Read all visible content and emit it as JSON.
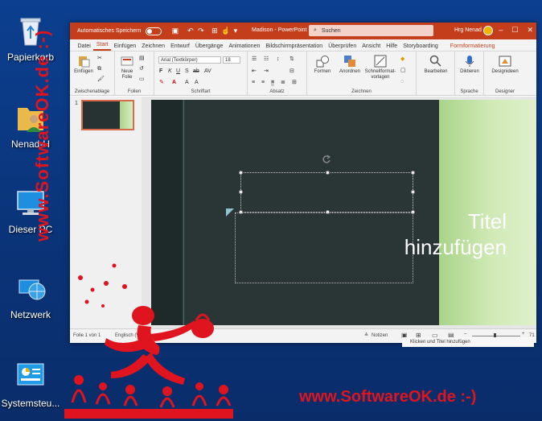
{
  "desktop": {
    "icons": [
      {
        "label": "Papierkorb",
        "icon": "recycle-bin-icon"
      },
      {
        "label": "Nenad-H",
        "icon": "user-folder-icon"
      },
      {
        "label": "Dieser PC",
        "icon": "computer-icon"
      },
      {
        "label": "Netzwerk",
        "icon": "network-icon"
      },
      {
        "label": "Systemsteu...",
        "icon": "control-panel-icon"
      }
    ],
    "watermark_vertical": "www.SoftwareOK.de :-)",
    "watermark_horizontal": "www.SoftwareOK.de :-)"
  },
  "app": {
    "autosave_label": "Automatisches Speichern",
    "window_title": "Madison  -  PowerPoint",
    "search_placeholder": "Suchen",
    "user_name": "Hrg Nenad",
    "accent": "#c43e1c"
  },
  "tabs": [
    "Datei",
    "Start",
    "Einfügen",
    "Zeichnen",
    "Entwurf",
    "Übergänge",
    "Animationen",
    "Bildschirmpräsentation",
    "Überprüfen",
    "Ansicht",
    "Hilfe",
    "Storyboarding"
  ],
  "active_tab": "Start",
  "context_tab": "Formformatierung",
  "ribbon": {
    "clipboard": {
      "paste": "Einfügen",
      "label": "Zwischenablage"
    },
    "slides": {
      "new_slide_line1": "Neue",
      "new_slide_line2": "Folie",
      "label": "Folien"
    },
    "font": {
      "name": "Arial (Textkörper)",
      "size": "18",
      "label": "Schriftart"
    },
    "paragraph": {
      "label": "Absatz"
    },
    "drawing": {
      "shapes": "Formen",
      "arrange": "Anordnen",
      "quickstyles_line1": "Schnellformat-",
      "quickstyles_line2": "vorlagen",
      "label": "Zeichnen"
    },
    "editing": {
      "label": "Bearbeiten"
    },
    "voice": {
      "dictate": "Diktieren",
      "label": "Sprache"
    },
    "designer": {
      "ideas": "Designideen",
      "label": "Designer"
    }
  },
  "slides_panel": {
    "number": "1"
  },
  "slide": {
    "title_line1": "Titel",
    "title_line2": "hinzufügen"
  },
  "status": {
    "slide_count": "Folie 1 von 1",
    "language": "Englisch (Vere",
    "notes": "Notizen",
    "zoom": "71",
    "tooltip": "Klicken und Titel hinzufügen"
  }
}
